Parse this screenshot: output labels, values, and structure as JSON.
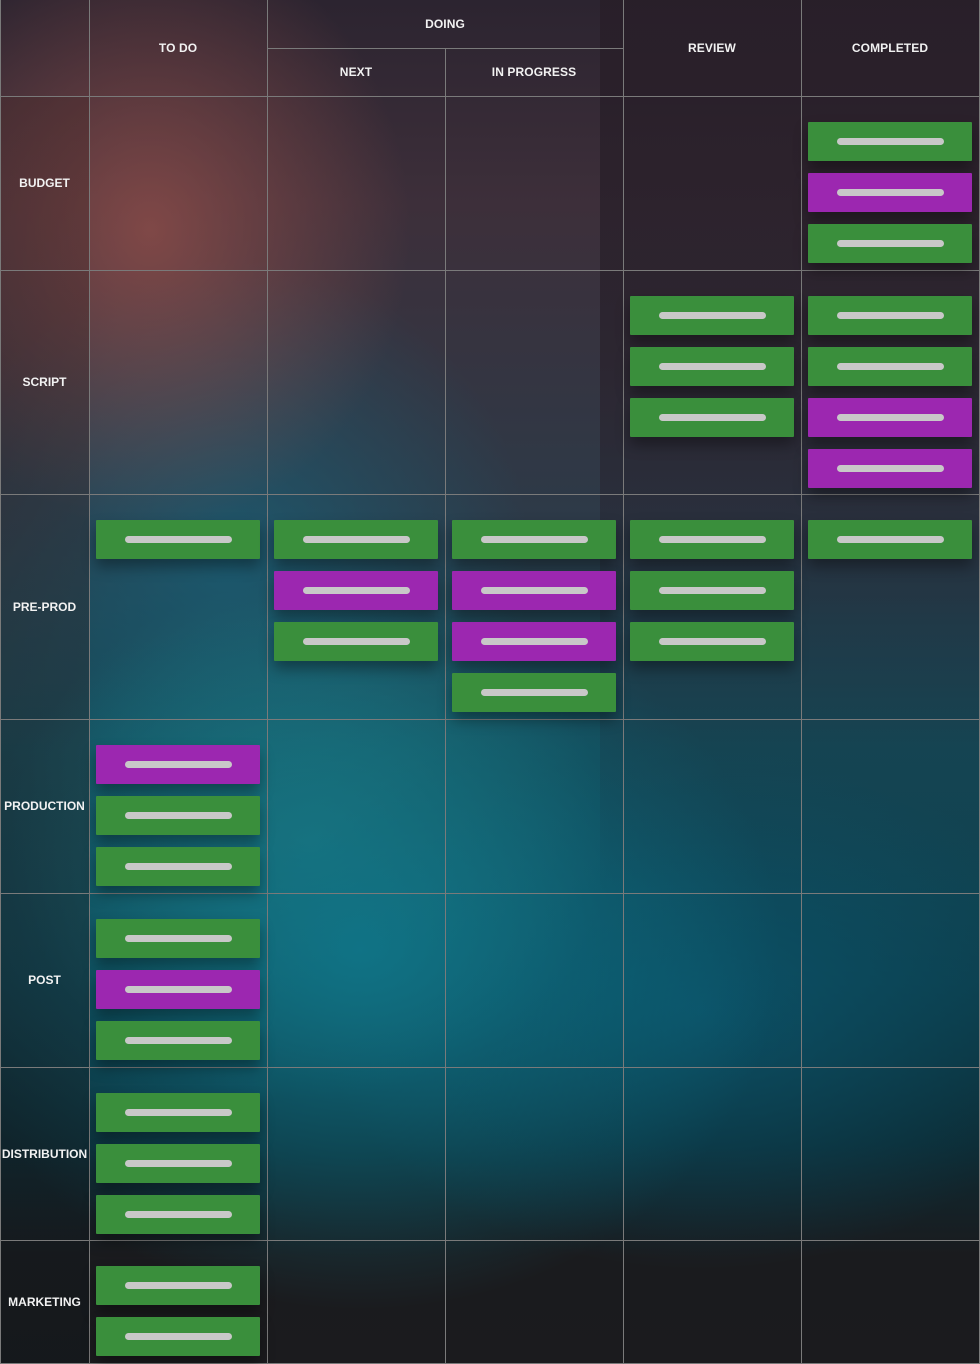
{
  "board": {
    "columns": {
      "todo": "TO DO",
      "doing": "DOING",
      "next": "NEXT",
      "in_progress": "IN PROGRESS",
      "review": "REVIEW",
      "completed": "COMPLETED"
    },
    "column_order": [
      "todo",
      "next",
      "in_progress",
      "review",
      "completed"
    ],
    "rows": [
      {
        "label": "BUDGET",
        "cards": {
          "todo": [],
          "next": [],
          "in_progress": [],
          "review": [],
          "completed": [
            "green",
            "purple",
            "green"
          ]
        }
      },
      {
        "label": "SCRIPT",
        "cards": {
          "todo": [],
          "next": [],
          "in_progress": [],
          "review": [
            "green",
            "green",
            "green"
          ],
          "completed": [
            "green",
            "green",
            "purple",
            "purple"
          ]
        }
      },
      {
        "label": "PRE-PROD",
        "cards": {
          "todo": [
            "green"
          ],
          "next": [
            "green",
            "purple",
            "green"
          ],
          "in_progress": [
            "green",
            "purple",
            "purple",
            "green"
          ],
          "review": [
            "green",
            "green",
            "green"
          ],
          "completed": [
            "green"
          ]
        }
      },
      {
        "label": "PRODUCTION",
        "cards": {
          "todo": [
            "purple",
            "green",
            "green"
          ],
          "next": [],
          "in_progress": [],
          "review": [],
          "completed": []
        }
      },
      {
        "label": "POST",
        "cards": {
          "todo": [
            "green",
            "purple",
            "green"
          ],
          "next": [],
          "in_progress": [],
          "review": [],
          "completed": []
        }
      },
      {
        "label": "DISTRIBUTION",
        "cards": {
          "todo": [
            "green",
            "green",
            "green"
          ],
          "next": [],
          "in_progress": [],
          "review": [],
          "completed": []
        }
      },
      {
        "label": "MARKETING",
        "cards": {
          "todo": [
            "green",
            "green"
          ],
          "next": [],
          "in_progress": [],
          "review": [],
          "completed": []
        }
      }
    ]
  },
  "colors": {
    "card_green": "#3a8f3c",
    "card_purple": "#9c27b0",
    "card_bar": "#c8c8c8",
    "grid_line": "#7a7a7a",
    "header_text": "#f2f2f2"
  }
}
